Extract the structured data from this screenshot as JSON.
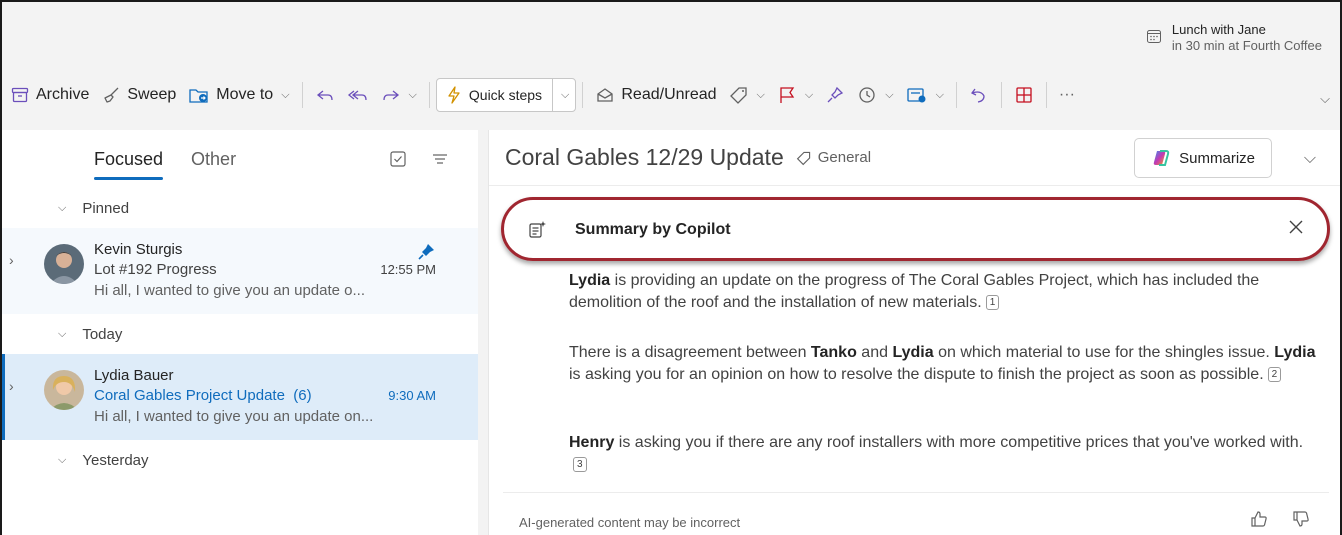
{
  "reminder": {
    "title": "Lunch with Jane",
    "detail": "in 30 min at Fourth Coffee"
  },
  "ribbon": {
    "archive": "Archive",
    "sweep": "Sweep",
    "move_to": "Move to",
    "quick_steps": "Quick steps",
    "read_unread": "Read/Unread",
    "more": "···"
  },
  "mail_list": {
    "tabs": {
      "focused": "Focused",
      "other": "Other"
    },
    "groups": {
      "pinned": "Pinned",
      "today": "Today",
      "yesterday": "Yesterday"
    },
    "messages": [
      {
        "sender": "Kevin Sturgis",
        "subject": "Lot #192 Progress",
        "time": "12:55 PM",
        "preview": "Hi all, I wanted to give you an update o..."
      },
      {
        "sender": "Lydia Bauer",
        "subject": "Coral Gables Project Update  (6)",
        "time": "9:30 AM",
        "preview": "Hi all, I wanted to give you an update on..."
      }
    ]
  },
  "reading": {
    "title": "Coral Gables 12/29 Update",
    "tag": "General",
    "summarize_label": "Summarize"
  },
  "copilot": {
    "title": "Summary by Copilot",
    "paragraphs": [
      {
        "bold1": "Lydia",
        "text1": " is providing an update on the progress of The Coral Gables Project, which has included the demolition of the roof and the installation of new materials.",
        "ref": "1"
      },
      {
        "pre": "There is a disagreement between ",
        "bold1": "Tanko",
        "mid": " and ",
        "bold2": "Lydia",
        "text1": " on which material to use for the shingles issue. ",
        "bold3": "Lydia",
        "text2": " is asking you for an opinion on how to resolve the dispute to finish the project as soon as possible.",
        "ref": "2"
      },
      {
        "bold1": "Henry",
        "text1": " is asking you if there are any roof installers with more competitive prices that you've worked with.",
        "ref": "3"
      }
    ],
    "disclaimer": "AI-generated content may be incorrect"
  },
  "colors": {
    "accent": "#0f6cbd",
    "highlight_ring": "#a02630",
    "flag": "#c50f1f"
  }
}
